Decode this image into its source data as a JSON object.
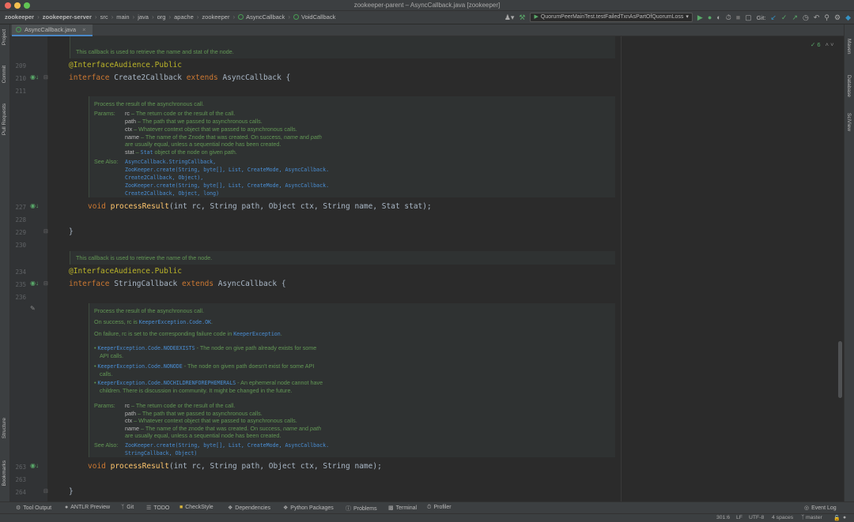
{
  "window": {
    "title": "zookeeper-parent – AsyncCallback.java [zookeeper]"
  },
  "breadcrumbs": [
    "zookeeper",
    "zookeeper-server",
    "src",
    "main",
    "java",
    "org",
    "apache",
    "zookeeper",
    "AsyncCallback",
    "VoidCallback"
  ],
  "toolbar": {
    "run_config": "QuorumPeerMainTest.testFailedTxnAsPartOfQuorumLoss",
    "git_label": "Git:"
  },
  "left_tools": [
    "Project",
    "Commit",
    "Pull Requests",
    "Structure",
    "Bookmarks"
  ],
  "right_tools": [
    "Maven",
    "Database",
    "SciView"
  ],
  "tab": {
    "label": "AsyncCallback.java"
  },
  "inspection": {
    "count": "6"
  },
  "line_numbers": {
    "l209": "209",
    "l210": "210",
    "l211": "211",
    "l227": "227",
    "l228": "228",
    "l229": "229",
    "l230": "230",
    "l234": "234",
    "l235": "235",
    "l236": "236",
    "l263": "263",
    "l263b": "263",
    "l264": "264"
  },
  "code": {
    "ann1_at": "@InterfaceAudience",
    "ann1_rest": ".Public",
    "decl1_kw": "interface ",
    "decl1_name": "Create2Callback ",
    "decl1_kw2": "extends ",
    "decl1_super": "AsyncCallback {",
    "m1_kw": "void ",
    "m1_name": "processResult",
    "m1_rest": "(int rc, String path, Object ctx, String name, Stat stat);",
    "close1": "}",
    "ann2_at": "@InterfaceAudience",
    "ann2_rest": ".Public",
    "decl2_kw": "interface ",
    "decl2_name": "StringCallback ",
    "decl2_kw2": "extends ",
    "decl2_super": "AsyncCallback {",
    "m2_kw": "void ",
    "m2_name": "processResult",
    "m2_rest": "(int rc, String path, Object ctx, String name);",
    "close2": "}"
  },
  "docs": {
    "top_partial": "This callback is used to retrieve the name and stat of the node.",
    "d1_summary": "Process the result of the asynchronous call.",
    "d1_params_label": "Params:",
    "d1_p_rc": "rc",
    "d1_p_rc_desc": " – The return code or the result of the call.",
    "d1_p_path": "path",
    "d1_p_path_desc": " – The path that we passed to asynchronous calls.",
    "d1_p_ctx": "ctx",
    "d1_p_ctx_desc": " – Whatever context object that we passed to asynchronous calls.",
    "d1_p_name": "name",
    "d1_p_name_desc_a": " – The name of the Znode that was created. On success, ",
    "d1_p_name_em1": "name",
    "d1_p_name_desc_b": " and ",
    "d1_p_name_em2": "path",
    "d1_p_name_desc_c": "are usually equal, unless a sequential node has been created.",
    "d1_p_stat": "stat",
    "d1_p_stat_desc_a": " – ",
    "d1_p_stat_link": "Stat",
    "d1_p_stat_desc_b": " object of the node on given path.",
    "d1_see_label": "See Also:",
    "d1_see_1": "AsyncCallback.StringCallback,",
    "d1_see_2": "ZooKeeper.create(String, byte[], List, CreateMode, AsyncCallback.",
    "d1_see_3": "Create2Callback, Object),",
    "d1_see_4": "ZooKeeper.create(String, byte[], List, CreateMode, AsyncCallback.",
    "d1_see_5": "Create2Callback, Object, long)",
    "d2_header": "This callback is used to retrieve the name of the node.",
    "d2_summary": "Process the result of the asynchronous call.",
    "d2_success_a": "On success, rc is ",
    "d2_success_link": "KeeperException.Code.OK",
    "d2_success_b": ".",
    "d2_failure_a": "On failure, rc is set to the corresponding failure code in ",
    "d2_failure_link": "KeeperException",
    "d2_failure_b": ".",
    "d2_b1_link": "KeeperException.Code.NODEEXISTS",
    "d2_b1_a": " - The node on give path already exists for some",
    "d2_b1_b": "API calls.",
    "d2_b2_link": "KeeperException.Code.NONODE",
    "d2_b2_a": " - The node on given path doesn't exist for some API",
    "d2_b2_b": "calls.",
    "d2_b3_link": "KeeperException.Code.NOCHILDRENFOREPHEMERALS",
    "d2_b3_a": " - An ephemeral node cannot have",
    "d2_b3_b": "children. There is discussion in community. It might be changed in the future.",
    "d2_params_label": "Params:",
    "d2_p_rc": "rc",
    "d2_p_rc_desc": " – The return code or the result of the call.",
    "d2_p_path": "path",
    "d2_p_path_desc": " – The path that we passed to asynchronous calls.",
    "d2_p_ctx": "ctx",
    "d2_p_ctx_desc": " – Whatever context object that we passed to asynchronous calls.",
    "d2_p_name": "name",
    "d2_p_name_desc_a": " – The name of the znode that was created. On success, ",
    "d2_p_name_em1": "name",
    "d2_p_name_desc_b": " and ",
    "d2_p_name_em2": "path",
    "d2_p_name_desc_c": "are usually equal, unless a sequential node has been created.",
    "d2_see_label": "See Also:",
    "d2_see_1": "ZooKeeper.create(String, byte[], List, CreateMode, AsyncCallback.",
    "d2_see_2": "StringCallback, Object)"
  },
  "bottom_tools": [
    "Tool Output",
    "ANTLR Preview",
    "Git",
    "TODO",
    "CheckStyle",
    "Dependencies",
    "Python Packages",
    "Problems",
    "Terminal",
    "Profiler"
  ],
  "event_log": "Event Log",
  "status": {
    "position": "301:6",
    "line_sep": "LF",
    "encoding": "UTF-8",
    "indent": "4 spaces",
    "branch": "master"
  }
}
